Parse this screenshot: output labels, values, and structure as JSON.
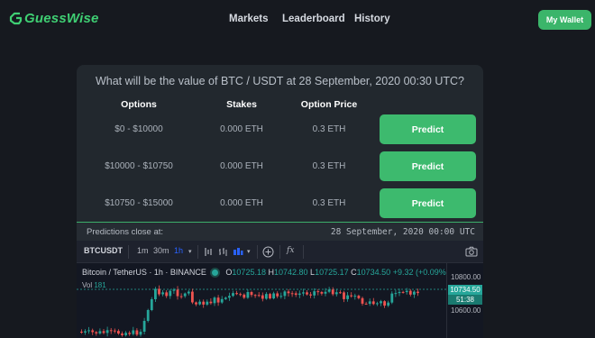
{
  "header": {
    "logo_text": "GuessWise",
    "nav": [
      "Markets",
      "Leaderboard",
      "History"
    ],
    "wallet_label": "My Wallet"
  },
  "card": {
    "question": "What will be the value of BTC / USDT at 28 September, 2020 00:30 UTC?",
    "columns": {
      "options": "Options",
      "stakes": "Stakes",
      "price": "Option Price"
    },
    "rows": [
      {
        "option": "$0 - $10000",
        "stake": "0.000 ETH",
        "price": "0.3 ETH",
        "action": "Predict"
      },
      {
        "option": "$10000 - $10750",
        "stake": "0.000 ETH",
        "price": "0.3 ETH",
        "action": "Predict"
      },
      {
        "option": "$10750 - $15000",
        "stake": "0.000 ETH",
        "price": "0.3 ETH",
        "action": "Predict"
      }
    ],
    "close_label": "Predictions close at:",
    "close_date": "28 September, 2020 00:00 UTC"
  },
  "chart_widget": {
    "symbol": "BTCUSDT",
    "intervals": [
      "1m",
      "30m",
      "1h"
    ],
    "active_interval": "1h",
    "fx_label": "fx",
    "pair_title": "Bitcoin / TetherUS · 1h · BINANCE",
    "ohlc": {
      "o_label": "O",
      "o": "10725.18",
      "h_label": "H",
      "h": "10742.80",
      "l_label": "L",
      "l": "10725.17",
      "c_label": "C",
      "c": "10734.50",
      "change": "+9.32 (+0.09%)"
    },
    "volume_label": "Vol",
    "volume_value": "181",
    "price_ticks": [
      "10800.00",
      "10600.00"
    ],
    "current_price": "10734.50",
    "countdown": "51:38",
    "colors": {
      "up": "#26a69a",
      "down": "#ef5350"
    },
    "icons": [
      "indicators-icon",
      "bar-style-icon",
      "candle-style-icon",
      "add-icon",
      "fx-icon",
      "camera-icon"
    ]
  }
}
